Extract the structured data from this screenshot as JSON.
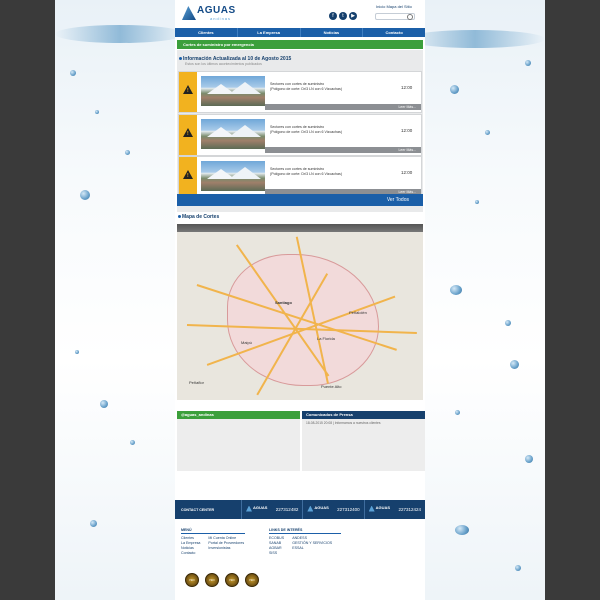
{
  "header": {
    "logo_text": "AGUAS",
    "logo_subtext": "andinas",
    "top_links": "Inicio  Mapa del Sitio",
    "search_placeholder": "",
    "social": [
      "f",
      "t",
      "▶"
    ]
  },
  "nav": {
    "items": [
      "Clientes",
      "La Empresa",
      "Noticias",
      "Contacto"
    ]
  },
  "cuts": {
    "section_title": "Cortes de suministro por emergencia",
    "header_title": "Información Actualizada al 10 de Agosto 2015",
    "header_subtitle": "Estos son los últimos acontecimientos publicados",
    "alerts": [
      {
        "line1": "Sectores con cortes de suministro",
        "line2": "(Polígono de corte: Dr/3 LN con 6 Vizcachas)",
        "time": "12:00",
        "more": "Leer Más..."
      },
      {
        "line1": "Sectores con cortes de suministro",
        "line2": "(Polígono de corte: Dr/3 LN con 6 Vizcachas)",
        "time": "12:00",
        "more": "Leer Más..."
      },
      {
        "line1": "Sectores con cortes de suministro",
        "line2": "(Polígono de corte: Dr/3 LN con 6 Vizcachas)",
        "time": "12:00",
        "more": "Leer Más..."
      }
    ],
    "view_all": "Ver Todos"
  },
  "map": {
    "title": "Mapa de Cortes",
    "labels": {
      "santiago": "Santiago",
      "maipu": "Maipú",
      "la_florida": "La Florida",
      "puente_alto": "Puente Alto",
      "penaflor": "Peñaflor",
      "penalolen": "Peñalolén"
    }
  },
  "social_box": {
    "title": "@aguas_andinas"
  },
  "press_box": {
    "title": "Comunicados de Prensa",
    "row": "18-08-2015 20:08 | Informamos a nuestros clientes"
  },
  "contact": {
    "label": "CONTACT CENTER",
    "items": [
      {
        "brand": "AGUAS",
        "number": "227312482"
      },
      {
        "brand": "AGUAS",
        "number": "227312400"
      },
      {
        "brand": "AGUAS",
        "number": "227312424"
      }
    ]
  },
  "footer": {
    "menu_title": "MENÚ",
    "menu_col1": [
      "Clientes",
      "La Empresa",
      "Noticias",
      "Contacto"
    ],
    "menu_col2": [
      "Mi Cuenta Online",
      "Portal de Proveedores",
      "Inversionistas"
    ],
    "links_title": "LINKS DE INTERÉS",
    "links_col1": [
      "ECOBUS",
      "SANAB",
      "AGBAR",
      "SISS"
    ],
    "links_col2": [
      "ANDESS",
      "GESTIÓN Y SERVICIOS",
      "ESSAL"
    ]
  },
  "badges": [
    "ISO",
    "ISO",
    "ISO",
    "ISO"
  ],
  "colors": {
    "brand_blue": "#1b5fa8",
    "dark_blue": "#16406d",
    "green": "#3b9f3b",
    "warning": "#f2b21f"
  }
}
